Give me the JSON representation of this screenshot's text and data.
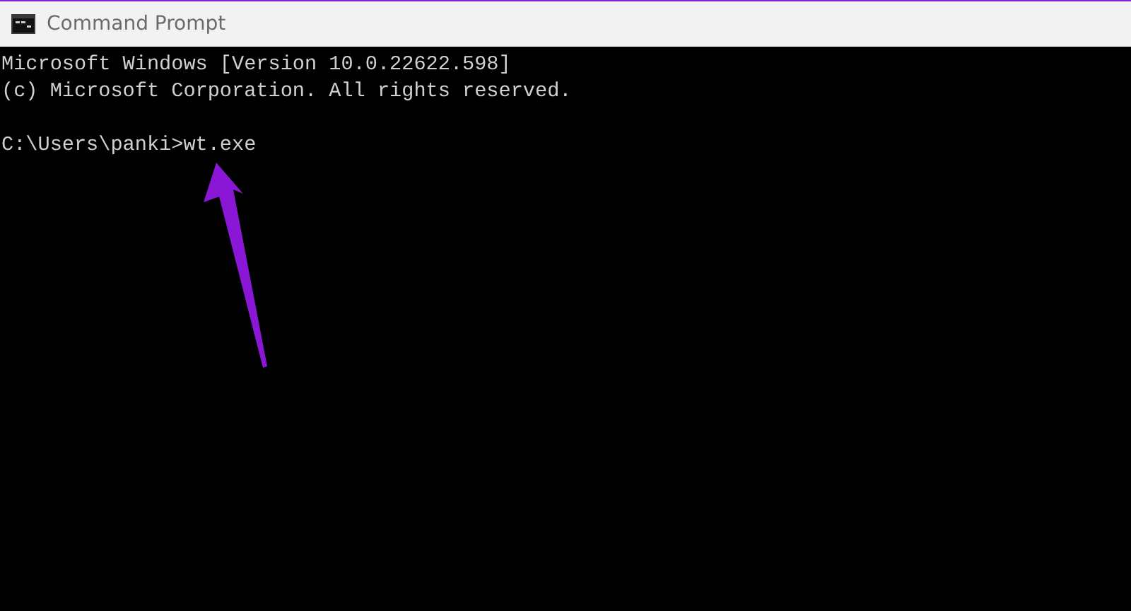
{
  "window": {
    "title": "Command Prompt"
  },
  "console": {
    "banner": [
      "Microsoft Windows [Version 10.0.22622.598]",
      "(c) Microsoft Corporation. All rights reserved."
    ],
    "prompt": "C:\\Users\\panki>wt.exe"
  }
}
